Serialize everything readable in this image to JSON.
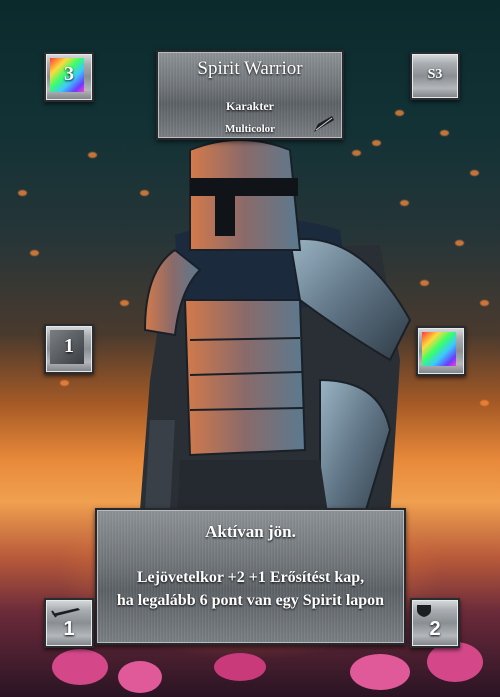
{
  "card": {
    "name": "Spirit Warrior",
    "type": "Karakter",
    "color": "Multicolor",
    "cost": "3",
    "set_code": "S3",
    "left_value": "1",
    "ability_header": "Aktívan jön.",
    "ability_line1": "Lejövetelkor +2 +1 Erősítést kap,",
    "ability_line2": "ha legalább 6 pont van egy Spirit lapon",
    "attack": "1",
    "defense": "2"
  },
  "icons": {
    "cost_gem": "rainbow-gem-icon",
    "right_gem": "rainbow-gem-icon",
    "type_corner": "blade-icon",
    "attack_icon": "sword-icon",
    "defense_icon": "shield-icon"
  },
  "colors": {
    "sky_top": "#0b2a2c",
    "sunset": "#e8893a",
    "text": "#ffffff",
    "panel": "#6f7479"
  }
}
